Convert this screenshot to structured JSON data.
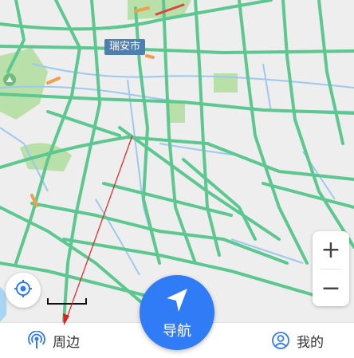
{
  "map": {
    "city_label": "瑞安市",
    "colors": {
      "background": "#eeeeee",
      "road": "#5cc88f",
      "water": "#9ec9ef",
      "park": "#b8e0a8",
      "congestion": "#f0a04b",
      "sea": "#a9d5f5",
      "annotation_arrow": "#e0201e"
    }
  },
  "controls": {
    "zoom_in_label": "+",
    "zoom_out_label": "−",
    "locate_icon": "locate-target-icon"
  },
  "bottom_bar": {
    "nearby_label": "周边",
    "nearby_icon": "location-signal-icon",
    "mine_label": "我的",
    "mine_icon": "user-circle-icon",
    "navigate_label": "导航",
    "navigate_icon": "navigation-arrow-icon",
    "accent_color": "#2f7cf6"
  }
}
